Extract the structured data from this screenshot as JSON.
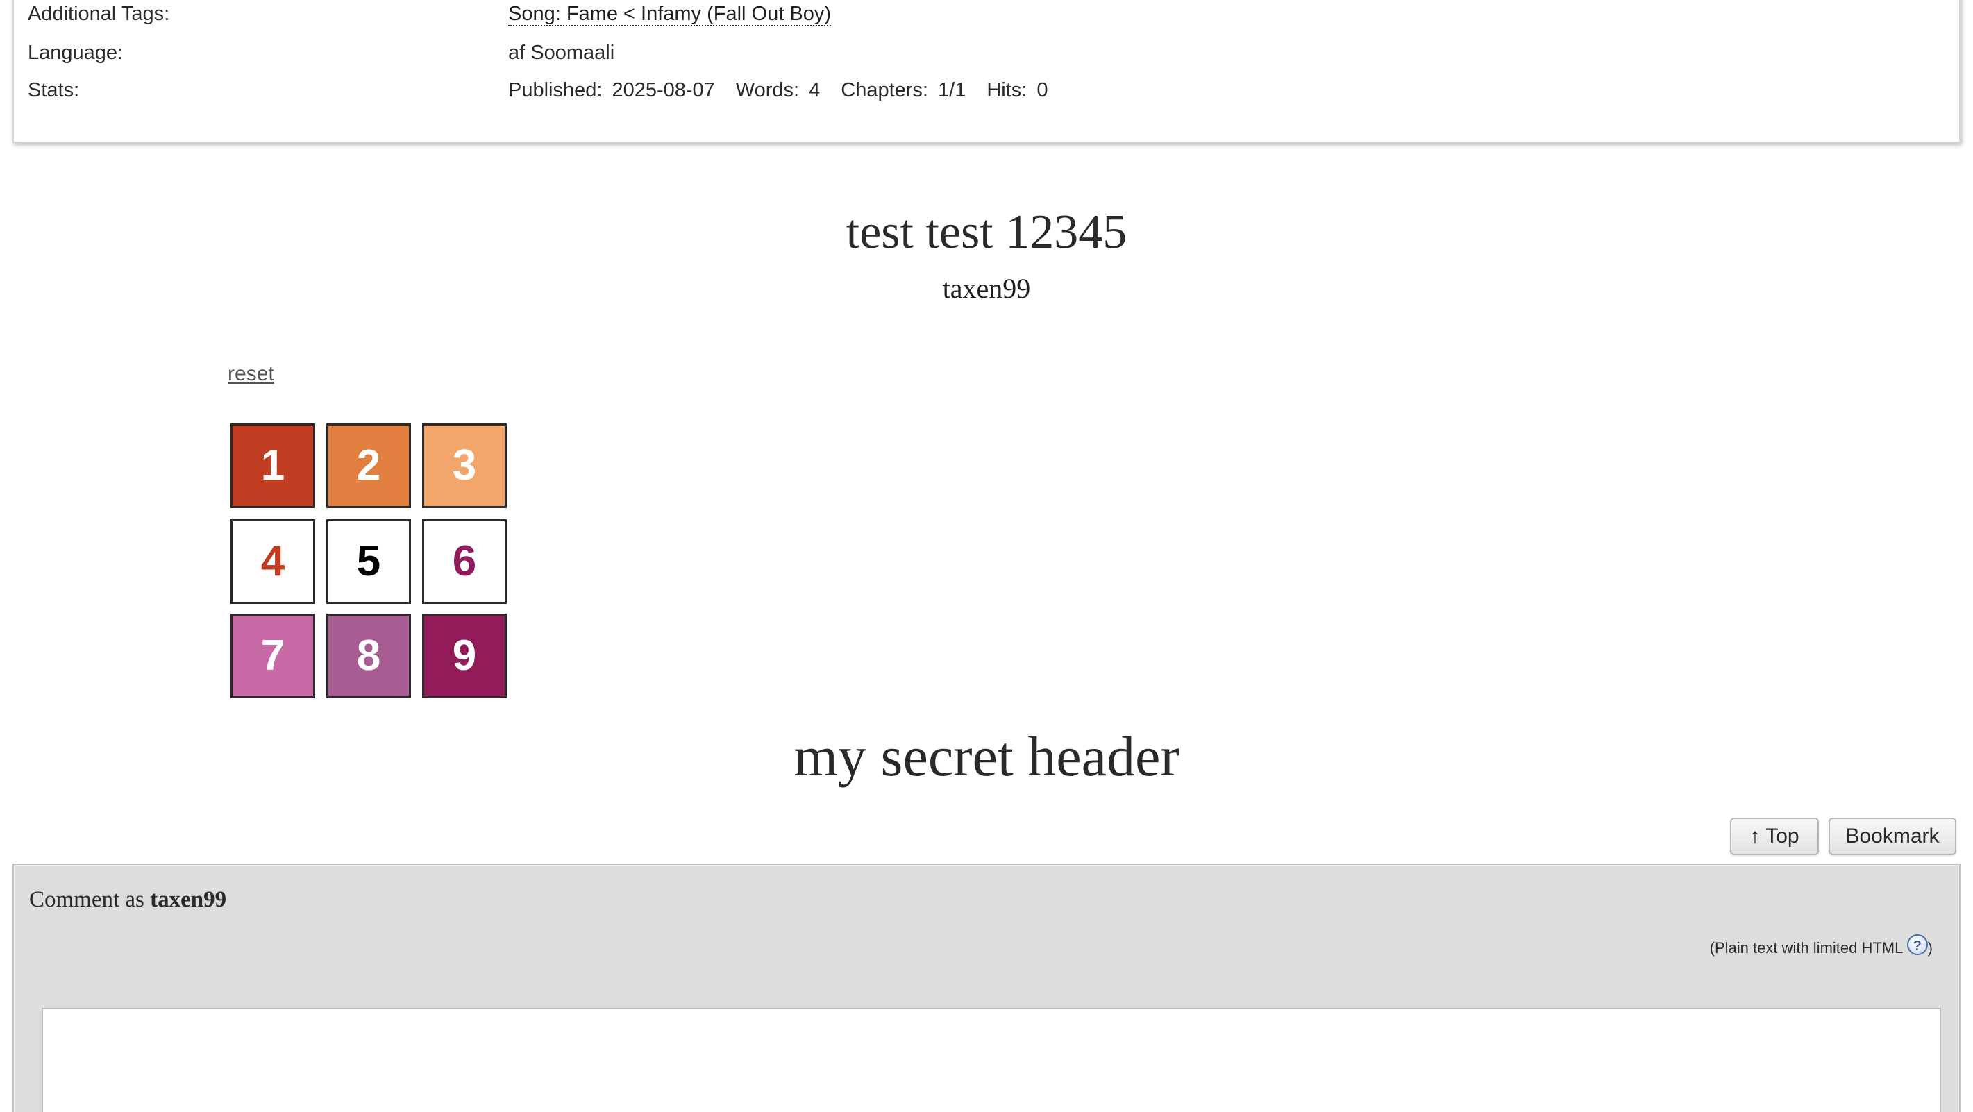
{
  "meta": {
    "tags_label": "Additional Tags:",
    "tags_value": "Song: Fame < Infamy (Fall Out Boy)",
    "language_label": "Language:",
    "language_value": "af Soomaali",
    "stats_label": "Stats:",
    "stats": {
      "published_label": "Published:",
      "published_value": "2025-08-07",
      "words_label": "Words:",
      "words_value": "4",
      "chapters_label": "Chapters:",
      "chapters_value": "1/1",
      "hits_label": "Hits:",
      "hits_value": "0"
    }
  },
  "work": {
    "title": "test test 12345",
    "author": "taxen99"
  },
  "grid": {
    "reset_label": "reset",
    "cells": [
      {
        "label": "1",
        "bg": "#c13d22",
        "fg": "#ffffff"
      },
      {
        "label": "2",
        "bg": "#e07f3f",
        "fg": "#ffffff"
      },
      {
        "label": "3",
        "bg": "#f2a66c",
        "fg": "#ffffff"
      },
      {
        "label": "4",
        "bg": "#ffffff",
        "fg": "#c13d22"
      },
      {
        "label": "5",
        "bg": "#ffffff",
        "fg": "#000000"
      },
      {
        "label": "6",
        "bg": "#ffffff",
        "fg": "#8f1d5e"
      },
      {
        "label": "7",
        "bg": "#c86aa6",
        "fg": "#ffffff"
      },
      {
        "label": "8",
        "bg": "#a75d92",
        "fg": "#ffffff"
      },
      {
        "label": "9",
        "bg": "#921b5a",
        "fg": "#ffffff"
      }
    ]
  },
  "secret_header": "my secret header",
  "buttons": {
    "top_label": "↑ Top",
    "bookmark_label": "Bookmark"
  },
  "comment": {
    "prefix": "Comment as",
    "user": "taxen99",
    "note_before": "(Plain text with limited HTML",
    "help_glyph": "?",
    "note_after": ")"
  }
}
